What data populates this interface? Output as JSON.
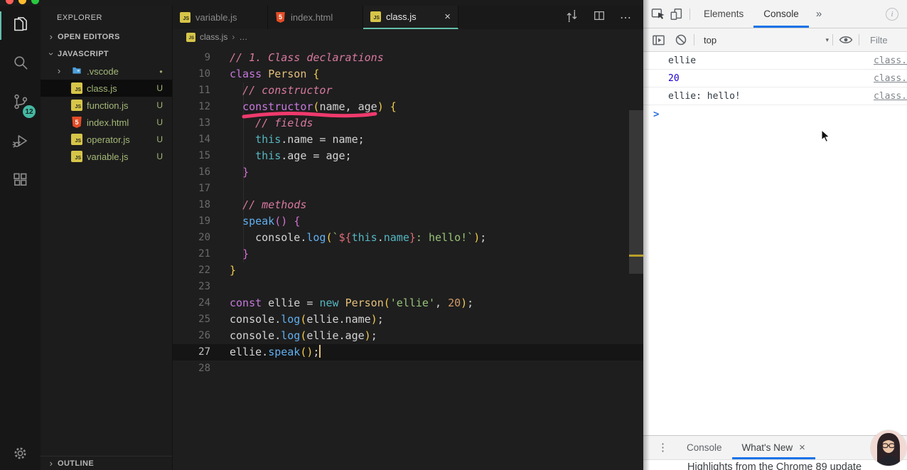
{
  "colors": {
    "vscode_accent_teal": "#63bfab",
    "devtools_accent_blue": "#1a73e8",
    "annotation_pink": "#ef3a6d",
    "untracked_green": "#a4b878",
    "console_number_blue": "#1c00cf"
  },
  "icons": {
    "js_badge": "JS",
    "html_badge": "5",
    "chevron_right": "›",
    "close": "×",
    "more_tabs": "»",
    "ellipsis": "⋯",
    "kebab": "⋮",
    "dropdown_arrow": "▾",
    "prompt": ">",
    "modified_dot": "●"
  },
  "vscode": {
    "activity_bar": {
      "items": [
        {
          "id": "explorer",
          "active": true
        },
        {
          "id": "search"
        },
        {
          "id": "source-control",
          "badge": "12"
        },
        {
          "id": "run-and-debug"
        },
        {
          "id": "extensions"
        }
      ],
      "settings_id": "settings"
    },
    "sidebar": {
      "title": "EXPLORER",
      "open_editors_label": "OPEN EDITORS",
      "folder_section_label": "JAVASCRIPT",
      "outline_label": "OUTLINE",
      "files": [
        {
          "label": ".vscode",
          "type": "folder",
          "badge": "●",
          "expandable": true
        },
        {
          "label": "class.js",
          "type": "js",
          "badge": "U",
          "selected": true
        },
        {
          "label": "function.js",
          "type": "js",
          "badge": "U"
        },
        {
          "label": "index.html",
          "type": "html",
          "badge": "U"
        },
        {
          "label": "operator.js",
          "type": "js",
          "badge": "U"
        },
        {
          "label": "variable.js",
          "type": "js",
          "badge": "U"
        }
      ]
    },
    "tabs": [
      {
        "label": "variable.js",
        "icon": "js"
      },
      {
        "label": "index.html",
        "icon": "html"
      },
      {
        "label": "class.js",
        "icon": "js",
        "active": true,
        "close_glyph": "×"
      }
    ],
    "breadcrumb": {
      "file": "class.js",
      "separator": "›",
      "rest": "…"
    },
    "code_lines": [
      {
        "num": 9,
        "tokens": [
          [
            "cm",
            "// 1. Class declarations"
          ]
        ]
      },
      {
        "num": 10,
        "tokens": [
          [
            "kw",
            "class"
          ],
          [
            "pl",
            " "
          ],
          [
            "cl",
            "Person"
          ],
          [
            "pl",
            " "
          ],
          [
            "b1",
            "{"
          ]
        ]
      },
      {
        "num": 11,
        "tokens": [
          [
            "pl",
            "  "
          ],
          [
            "cm",
            "// constructor"
          ]
        ]
      },
      {
        "num": 12,
        "tokens": [
          [
            "pl",
            "  "
          ],
          [
            "kw",
            "constructor"
          ],
          [
            "b1",
            "("
          ],
          [
            "pl",
            "name, age"
          ],
          [
            "b1",
            ")"
          ],
          [
            "pl",
            " "
          ],
          [
            "b1",
            "{"
          ]
        ]
      },
      {
        "num": 13,
        "tokens": [
          [
            "pl",
            "    "
          ],
          [
            "cm",
            "// fields"
          ]
        ]
      },
      {
        "num": 14,
        "tokens": [
          [
            "pl",
            "    "
          ],
          [
            "cy",
            "this"
          ],
          [
            "pl",
            ".name = name;"
          ]
        ]
      },
      {
        "num": 15,
        "tokens": [
          [
            "pl",
            "    "
          ],
          [
            "cy",
            "this"
          ],
          [
            "pl",
            ".age = age;"
          ]
        ]
      },
      {
        "num": 16,
        "tokens": [
          [
            "pl",
            "  "
          ],
          [
            "b2",
            "}"
          ]
        ]
      },
      {
        "num": 17,
        "tokens": []
      },
      {
        "num": 18,
        "tokens": [
          [
            "pl",
            "  "
          ],
          [
            "cm",
            "// methods"
          ]
        ]
      },
      {
        "num": 19,
        "tokens": [
          [
            "pl",
            "  "
          ],
          [
            "fn",
            "speak"
          ],
          [
            "b2",
            "()"
          ],
          [
            "pl",
            " "
          ],
          [
            "b2",
            "{"
          ]
        ]
      },
      {
        "num": 20,
        "tokens": [
          [
            "pl",
            "    console."
          ],
          [
            "fn",
            "log"
          ],
          [
            "b1",
            "("
          ],
          [
            "st",
            "`"
          ],
          [
            "tp",
            "${"
          ],
          [
            "cy",
            "this"
          ],
          [
            "pl",
            "."
          ],
          [
            "cy",
            "name"
          ],
          [
            "tp",
            "}"
          ],
          [
            "st",
            ": hello!`"
          ],
          [
            "b1",
            ")"
          ],
          [
            "pl",
            ";"
          ]
        ]
      },
      {
        "num": 21,
        "tokens": [
          [
            "pl",
            "  "
          ],
          [
            "b2",
            "}"
          ]
        ]
      },
      {
        "num": 22,
        "tokens": [
          [
            "b1",
            "}"
          ]
        ]
      },
      {
        "num": 23,
        "tokens": []
      },
      {
        "num": 24,
        "tokens": [
          [
            "kw",
            "const"
          ],
          [
            "pl",
            " ellie = "
          ],
          [
            "cy",
            "new"
          ],
          [
            "pl",
            " "
          ],
          [
            "cl",
            "Person"
          ],
          [
            "b1",
            "("
          ],
          [
            "st",
            "'ellie'"
          ],
          [
            "pl",
            ", "
          ],
          [
            "nu",
            "20"
          ],
          [
            "b1",
            ")"
          ],
          [
            "pl",
            ";"
          ]
        ]
      },
      {
        "num": 25,
        "tokens": [
          [
            "pl",
            "console."
          ],
          [
            "fn",
            "log"
          ],
          [
            "b1",
            "("
          ],
          [
            "pl",
            "ellie.name"
          ],
          [
            "b1",
            ")"
          ],
          [
            "pl",
            ";"
          ]
        ]
      },
      {
        "num": 26,
        "tokens": [
          [
            "pl",
            "console."
          ],
          [
            "fn",
            "log"
          ],
          [
            "b1",
            "("
          ],
          [
            "pl",
            "ellie.age"
          ],
          [
            "b1",
            ")"
          ],
          [
            "pl",
            ";"
          ]
        ]
      },
      {
        "num": 27,
        "tokens": [
          [
            "pl",
            "ellie."
          ],
          [
            "fn",
            "speak"
          ],
          [
            "b1",
            "()"
          ],
          [
            "pl",
            ";"
          ]
        ],
        "current": true,
        "cursor": true
      },
      {
        "num": 28,
        "tokens": []
      }
    ]
  },
  "devtools": {
    "tabs": [
      {
        "label": "Elements"
      },
      {
        "label": "Console",
        "active": true
      }
    ],
    "toolbar": {
      "context": "top",
      "filter_text": "Filte"
    },
    "console": {
      "rows": [
        {
          "text": "ellie",
          "kind": "string",
          "source": "class."
        },
        {
          "text": "20",
          "kind": "number",
          "source": "class."
        },
        {
          "text": "ellie: hello!",
          "kind": "string",
          "source": "class."
        }
      ]
    },
    "drawer": {
      "tabs": [
        {
          "label": "Console"
        },
        {
          "label": "What's New",
          "active": true,
          "close_glyph": "×"
        }
      ],
      "partial_text": "Highlights from the Chrome 89 update"
    }
  }
}
